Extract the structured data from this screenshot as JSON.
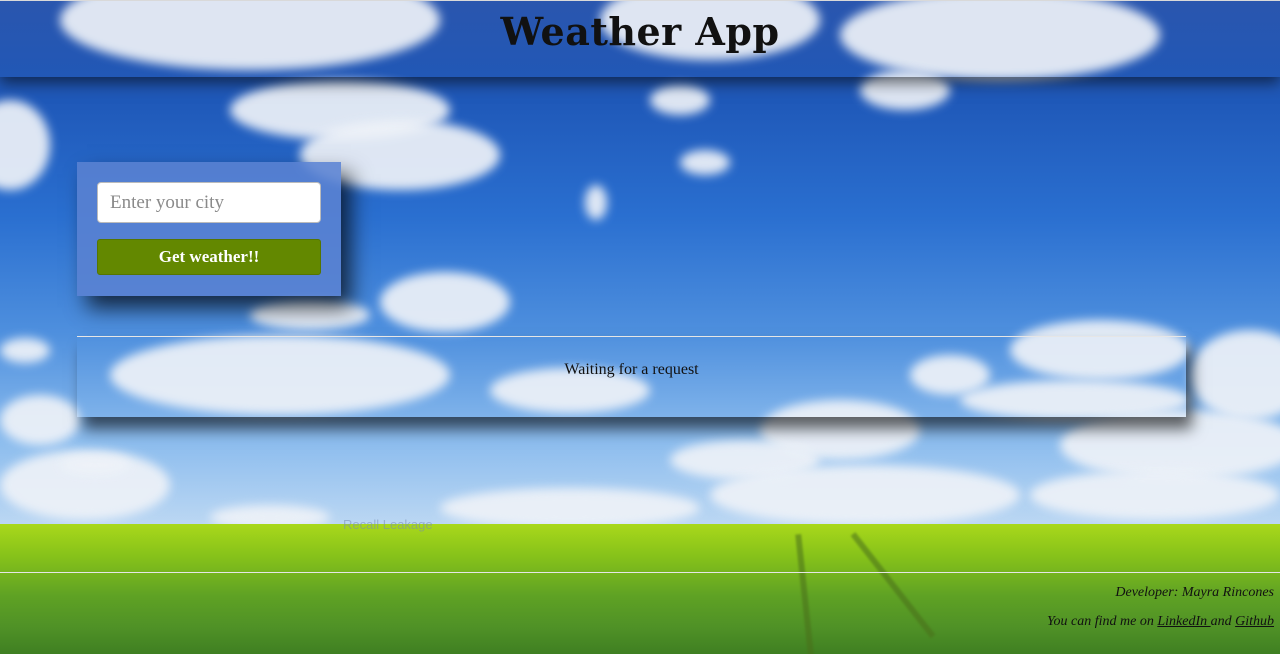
{
  "header": {
    "title": "Weather App"
  },
  "search": {
    "placeholder": "Enter your city",
    "value": "",
    "button_label": "Get weather!!"
  },
  "result": {
    "status": "Waiting for a request"
  },
  "footer": {
    "developer": "Developer: Mayra Rincones",
    "find_prefix": "You can find me on ",
    "linkedin_label": "LinkedIn ",
    "and_text": " and ",
    "github_label": "Github"
  },
  "background": {
    "watermark": "Recall Leakage"
  },
  "colors": {
    "button": "#638800",
    "panel": "#5a82d2",
    "sky": "#1f58b8",
    "grass": "#86c21a"
  }
}
